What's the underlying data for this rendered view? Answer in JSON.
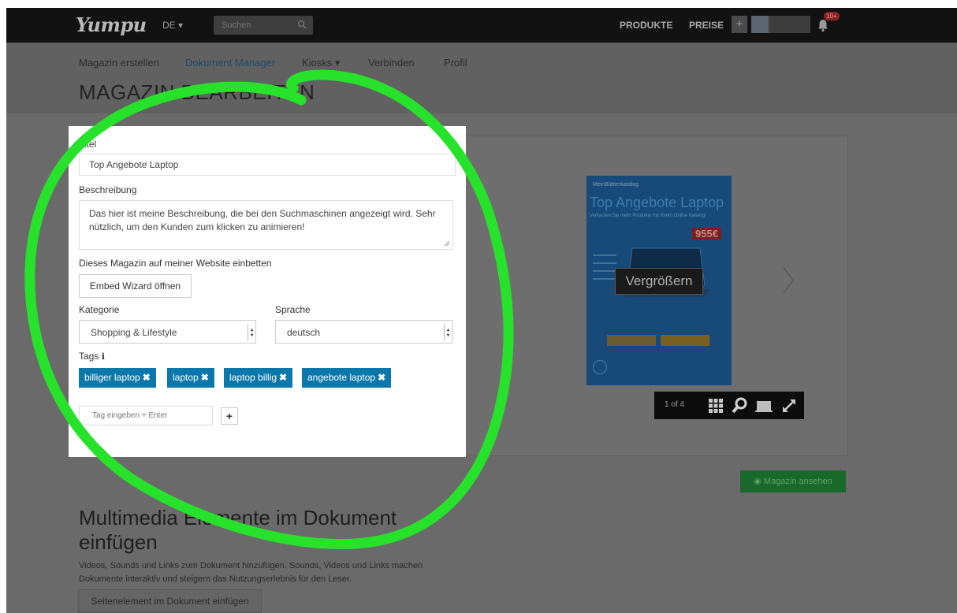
{
  "navbar": {
    "logo": "Yumpu",
    "lang": "DE",
    "search_placeholder": "Suchen",
    "produkte": "PRODUKTE",
    "preise": "PREISE",
    "plus": "+",
    "notifications_badge": "10+"
  },
  "subnav": {
    "items": [
      "Magazin erstellen",
      "Dokument Manager",
      "Kiosks",
      "Verbinden",
      "Profil"
    ]
  },
  "page_title": "MAGAZIN BEARBEITEN",
  "form": {
    "titel_label": "Titel",
    "titel_value": "Top Angebote Laptop",
    "beschreibung_label": "Beschreibung",
    "beschreibung_value": "Das hier ist meine Beschreibung, die bei den Suchmaschinen angezeigt wird. Sehr nützlich, um den Kunden zum klicken zu animieren!",
    "embed_label": "Dieses Magazin auf meiner Website einbetten",
    "embed_button": "Embed Wizard öffnen",
    "kategorie_label": "Kategorie",
    "kategorie_value": "Shopping & Lifestyle",
    "sprache_label": "Sprache",
    "sprache_value": "deutsch",
    "tags_label": "Tags",
    "tags": [
      "billiger laptop",
      "laptop",
      "laptop billig",
      "angebote laptop"
    ],
    "tag_input_placeholder": "Tag eingeben + Enter",
    "tag_add": "+"
  },
  "viewer": {
    "cover_brand": "MeinBlätterkatalog",
    "cover_title": "Top Angebote Laptop",
    "cover_sub": "Verkaufen Sie mehr Produkte mit Ihrem Online Katalog!",
    "cover_price": "955€",
    "zoom_button": "Vergrößern",
    "page_count": "1 of 4"
  },
  "view_magazine_button": "Magazin ansehen",
  "multimedia": {
    "title": "Multimedia Elemente im Dokument einfügen",
    "description": "Videos, Sounds und Links zum Dokument hinzufügen. Sounds, Videos und Links machen Dokumente interaktiv und steigern das Nutzungserlebnis für den Leser.",
    "button": "Seitenelement im Dokument einfügen"
  },
  "colors": {
    "navbar_bg": "#121212",
    "overlay_bg": "#6a6a6a",
    "tag_bg": "#0b77aa",
    "view_button_bg": "#196a2a",
    "annotation_stroke": "#27e22b"
  },
  "icons": [
    "search-icon",
    "chevron-down-icon",
    "bell-icon",
    "info-icon",
    "close-icon",
    "eye-icon",
    "grid-icon",
    "magnifier-icon",
    "monitor-icon",
    "fullscreen-icon",
    "chevron-right-icon"
  ]
}
